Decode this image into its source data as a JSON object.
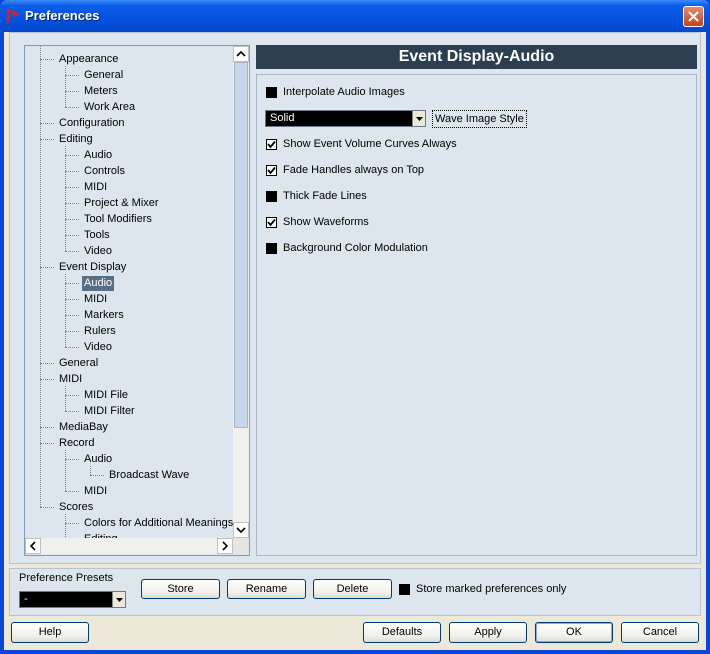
{
  "window": {
    "title": "Preferences"
  },
  "tree": {
    "items": [
      {
        "label": "Appearance",
        "level": 1
      },
      {
        "label": "General",
        "level": 2
      },
      {
        "label": "Meters",
        "level": 2
      },
      {
        "label": "Work Area",
        "level": 2
      },
      {
        "label": "Configuration",
        "level": 1
      },
      {
        "label": "Editing",
        "level": 1
      },
      {
        "label": "Audio",
        "level": 2
      },
      {
        "label": "Controls",
        "level": 2
      },
      {
        "label": "MIDI",
        "level": 2
      },
      {
        "label": "Project & Mixer",
        "level": 2
      },
      {
        "label": "Tool Modifiers",
        "level": 2
      },
      {
        "label": "Tools",
        "level": 2
      },
      {
        "label": "Video",
        "level": 2
      },
      {
        "label": "Event Display",
        "level": 1
      },
      {
        "label": "Audio",
        "level": 2,
        "selected": true
      },
      {
        "label": "MIDI",
        "level": 2
      },
      {
        "label": "Markers",
        "level": 2
      },
      {
        "label": "Rulers",
        "level": 2
      },
      {
        "label": "Video",
        "level": 2
      },
      {
        "label": "General",
        "level": 1
      },
      {
        "label": "MIDI",
        "level": 1
      },
      {
        "label": "MIDI File",
        "level": 2
      },
      {
        "label": "MIDI Filter",
        "level": 2
      },
      {
        "label": "MediaBay",
        "level": 1
      },
      {
        "label": "Record",
        "level": 1
      },
      {
        "label": "Audio",
        "level": 2
      },
      {
        "label": "Broadcast Wave",
        "level": 3
      },
      {
        "label": "MIDI",
        "level": 2
      },
      {
        "label": "Scores",
        "level": 1
      },
      {
        "label": "Colors for Additional Meanings",
        "level": 2
      },
      {
        "label": "Editing",
        "level": 2
      }
    ]
  },
  "panel": {
    "header": "Event Display-Audio",
    "options": [
      {
        "label": "Interpolate Audio Images",
        "checked": false
      },
      {
        "label": "Show Event Volume Curves Always",
        "checked": true
      },
      {
        "label": "Fade Handles always on Top",
        "checked": true
      },
      {
        "label": "Thick Fade Lines",
        "checked": false
      },
      {
        "label": "Show Waveforms",
        "checked": true
      },
      {
        "label": "Background Color Modulation",
        "checked": false
      }
    ],
    "wave_style": {
      "value": "Solid",
      "label": "Wave Image Style"
    }
  },
  "presets": {
    "label": "Preference Presets",
    "value": "-",
    "store": "Store",
    "rename": "Rename",
    "delete": "Delete",
    "store_marked_label": "Store marked preferences only",
    "store_marked_checked": false
  },
  "footer": {
    "help": "Help",
    "defaults": "Defaults",
    "apply": "Apply",
    "ok": "OK",
    "cancel": "Cancel"
  },
  "colors": {
    "selection": "#586e86",
    "header_bg": "#2b3f50",
    "title_bar": "#0a5ce8"
  }
}
